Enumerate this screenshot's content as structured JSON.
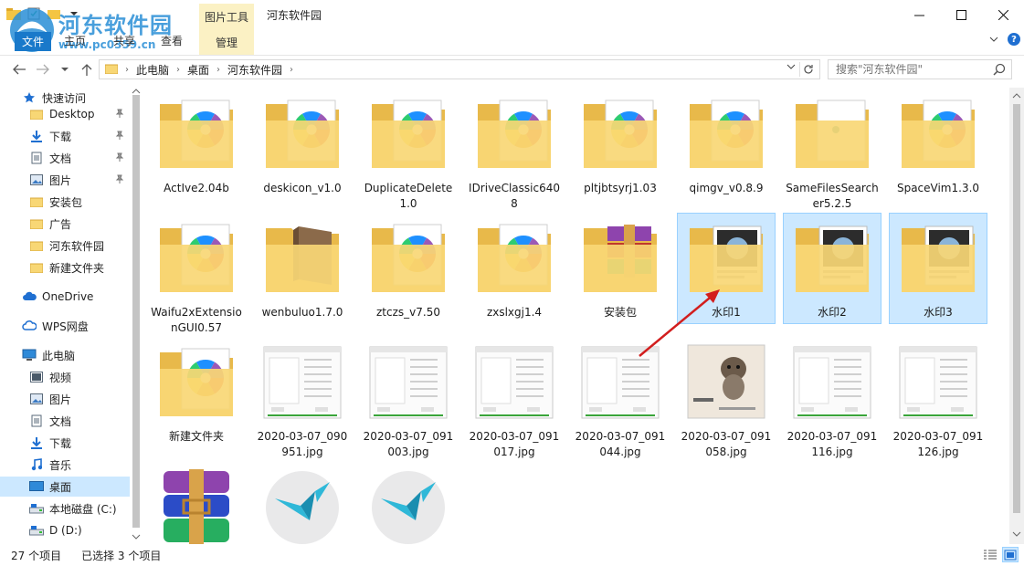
{
  "window": {
    "title": "河东软件园",
    "context_tab_group": "图片工具",
    "minimize": "minimize",
    "maximize": "maximize",
    "close": "close"
  },
  "watermark": {
    "text": "河东软件园",
    "url": "www.pc0359.cn"
  },
  "ribbon": {
    "tabs": [
      "文件",
      "主页",
      "共享",
      "查看"
    ],
    "manage_tab": "管理"
  },
  "address": {
    "crumbs": [
      "此电脑",
      "桌面",
      "河东软件园"
    ],
    "search_placeholder": "搜索\"河东软件园\""
  },
  "navpane": {
    "items": [
      {
        "label": "快速访问",
        "icon": "star-icon",
        "pinned": false,
        "indent": 0
      },
      {
        "label": "Desktop",
        "icon": "folder-icon",
        "pinned": true,
        "indent": 1
      },
      {
        "label": "下载",
        "icon": "download-icon",
        "pinned": true,
        "indent": 1
      },
      {
        "label": "文档",
        "icon": "document-icon",
        "pinned": true,
        "indent": 1
      },
      {
        "label": "图片",
        "icon": "pictures-icon",
        "pinned": true,
        "indent": 1
      },
      {
        "label": "安装包",
        "icon": "folder-icon",
        "pinned": false,
        "indent": 1
      },
      {
        "label": "广告",
        "icon": "folder-icon",
        "pinned": false,
        "indent": 1
      },
      {
        "label": "河东软件园",
        "icon": "folder-icon",
        "pinned": false,
        "indent": 1
      },
      {
        "label": "新建文件夹",
        "icon": "folder-icon",
        "pinned": false,
        "indent": 1
      },
      {
        "label": "OneDrive",
        "icon": "cloud-icon",
        "pinned": false,
        "indent": 0
      },
      {
        "label": "WPS网盘",
        "icon": "wps-cloud-icon",
        "pinned": false,
        "indent": 0
      },
      {
        "label": "此电脑",
        "icon": "computer-icon",
        "pinned": false,
        "indent": 0
      },
      {
        "label": "视频",
        "icon": "video-icon",
        "pinned": false,
        "indent": 1
      },
      {
        "label": "图片",
        "icon": "pictures-icon",
        "pinned": false,
        "indent": 1
      },
      {
        "label": "文档",
        "icon": "document-icon",
        "pinned": false,
        "indent": 1
      },
      {
        "label": "下载",
        "icon": "download-icon",
        "pinned": false,
        "indent": 1
      },
      {
        "label": "音乐",
        "icon": "music-icon",
        "pinned": false,
        "indent": 1
      },
      {
        "label": "桌面",
        "icon": "desktop-icon",
        "pinned": false,
        "indent": 1,
        "selected": true
      },
      {
        "label": "本地磁盘 (C:)",
        "icon": "drive-icon",
        "pinned": false,
        "indent": 1
      },
      {
        "label": "D (D:)",
        "icon": "drive-icon",
        "pinned": false,
        "indent": 1
      }
    ]
  },
  "files": [
    {
      "name": "ActIve2.04b",
      "kind": "folder-pinwheel",
      "selected": false
    },
    {
      "name": "deskicon_v1.0",
      "kind": "folder-pinwheel",
      "selected": false
    },
    {
      "name": "DuplicateDelete1.0",
      "kind": "folder-pinwheel",
      "selected": false
    },
    {
      "name": "IDriveClassic6408",
      "kind": "folder-pinwheel",
      "selected": false
    },
    {
      "name": "pltjbtsyrj1.03",
      "kind": "folder-pinwheel",
      "selected": false
    },
    {
      "name": "qimgv_v0.8.9",
      "kind": "folder-pinwheel",
      "selected": false
    },
    {
      "name": "SameFilesSearcher5.2.5",
      "kind": "folder-doc",
      "selected": false
    },
    {
      "name": "SpaceVim1.3.0",
      "kind": "folder-pinwheel",
      "selected": false
    },
    {
      "name": "Waifu2xExtensionGUI0.57",
      "kind": "folder-pinwheel",
      "selected": false
    },
    {
      "name": "wenbuluo1.7.0",
      "kind": "folder-brown",
      "selected": false
    },
    {
      "name": "ztczs_v7.50",
      "kind": "folder-pinwheel",
      "selected": false
    },
    {
      "name": "zxslxgj1.4",
      "kind": "folder-pinwheel",
      "selected": false
    },
    {
      "name": "安装包",
      "kind": "folder-rar",
      "selected": false
    },
    {
      "name": "水印1",
      "kind": "folder-image",
      "selected": true
    },
    {
      "name": "水印2",
      "kind": "folder-image",
      "selected": true
    },
    {
      "name": "水印3",
      "kind": "folder-image",
      "selected": true
    },
    {
      "name": "新建文件夹",
      "kind": "folder-pinwheel",
      "selected": false
    },
    {
      "name": "2020-03-07_090951.jpg",
      "kind": "screenshot",
      "selected": false
    },
    {
      "name": "2020-03-07_091003.jpg",
      "kind": "screenshot",
      "selected": false
    },
    {
      "name": "2020-03-07_091017.jpg",
      "kind": "screenshot",
      "selected": false
    },
    {
      "name": "2020-03-07_091044.jpg",
      "kind": "screenshot",
      "selected": false
    },
    {
      "name": "2020-03-07_091058.jpg",
      "kind": "photo-dog",
      "selected": false
    },
    {
      "name": "2020-03-07_091116.jpg",
      "kind": "screenshot",
      "selected": false
    },
    {
      "name": "2020-03-07_091126.jpg",
      "kind": "screenshot",
      "selected": false
    },
    {
      "name": "",
      "kind": "winrar",
      "selected": false
    },
    {
      "name": "",
      "kind": "bird",
      "selected": false
    },
    {
      "name": "",
      "kind": "bird",
      "selected": false
    }
  ],
  "status": {
    "count": "27 个项目",
    "selection": "已选择 3 个项目"
  },
  "colors": {
    "selection": "#cce8ff",
    "context_tab": "#fbf1c4",
    "folder": "#f8d775",
    "annotation_arrow": "#d21e1e"
  }
}
